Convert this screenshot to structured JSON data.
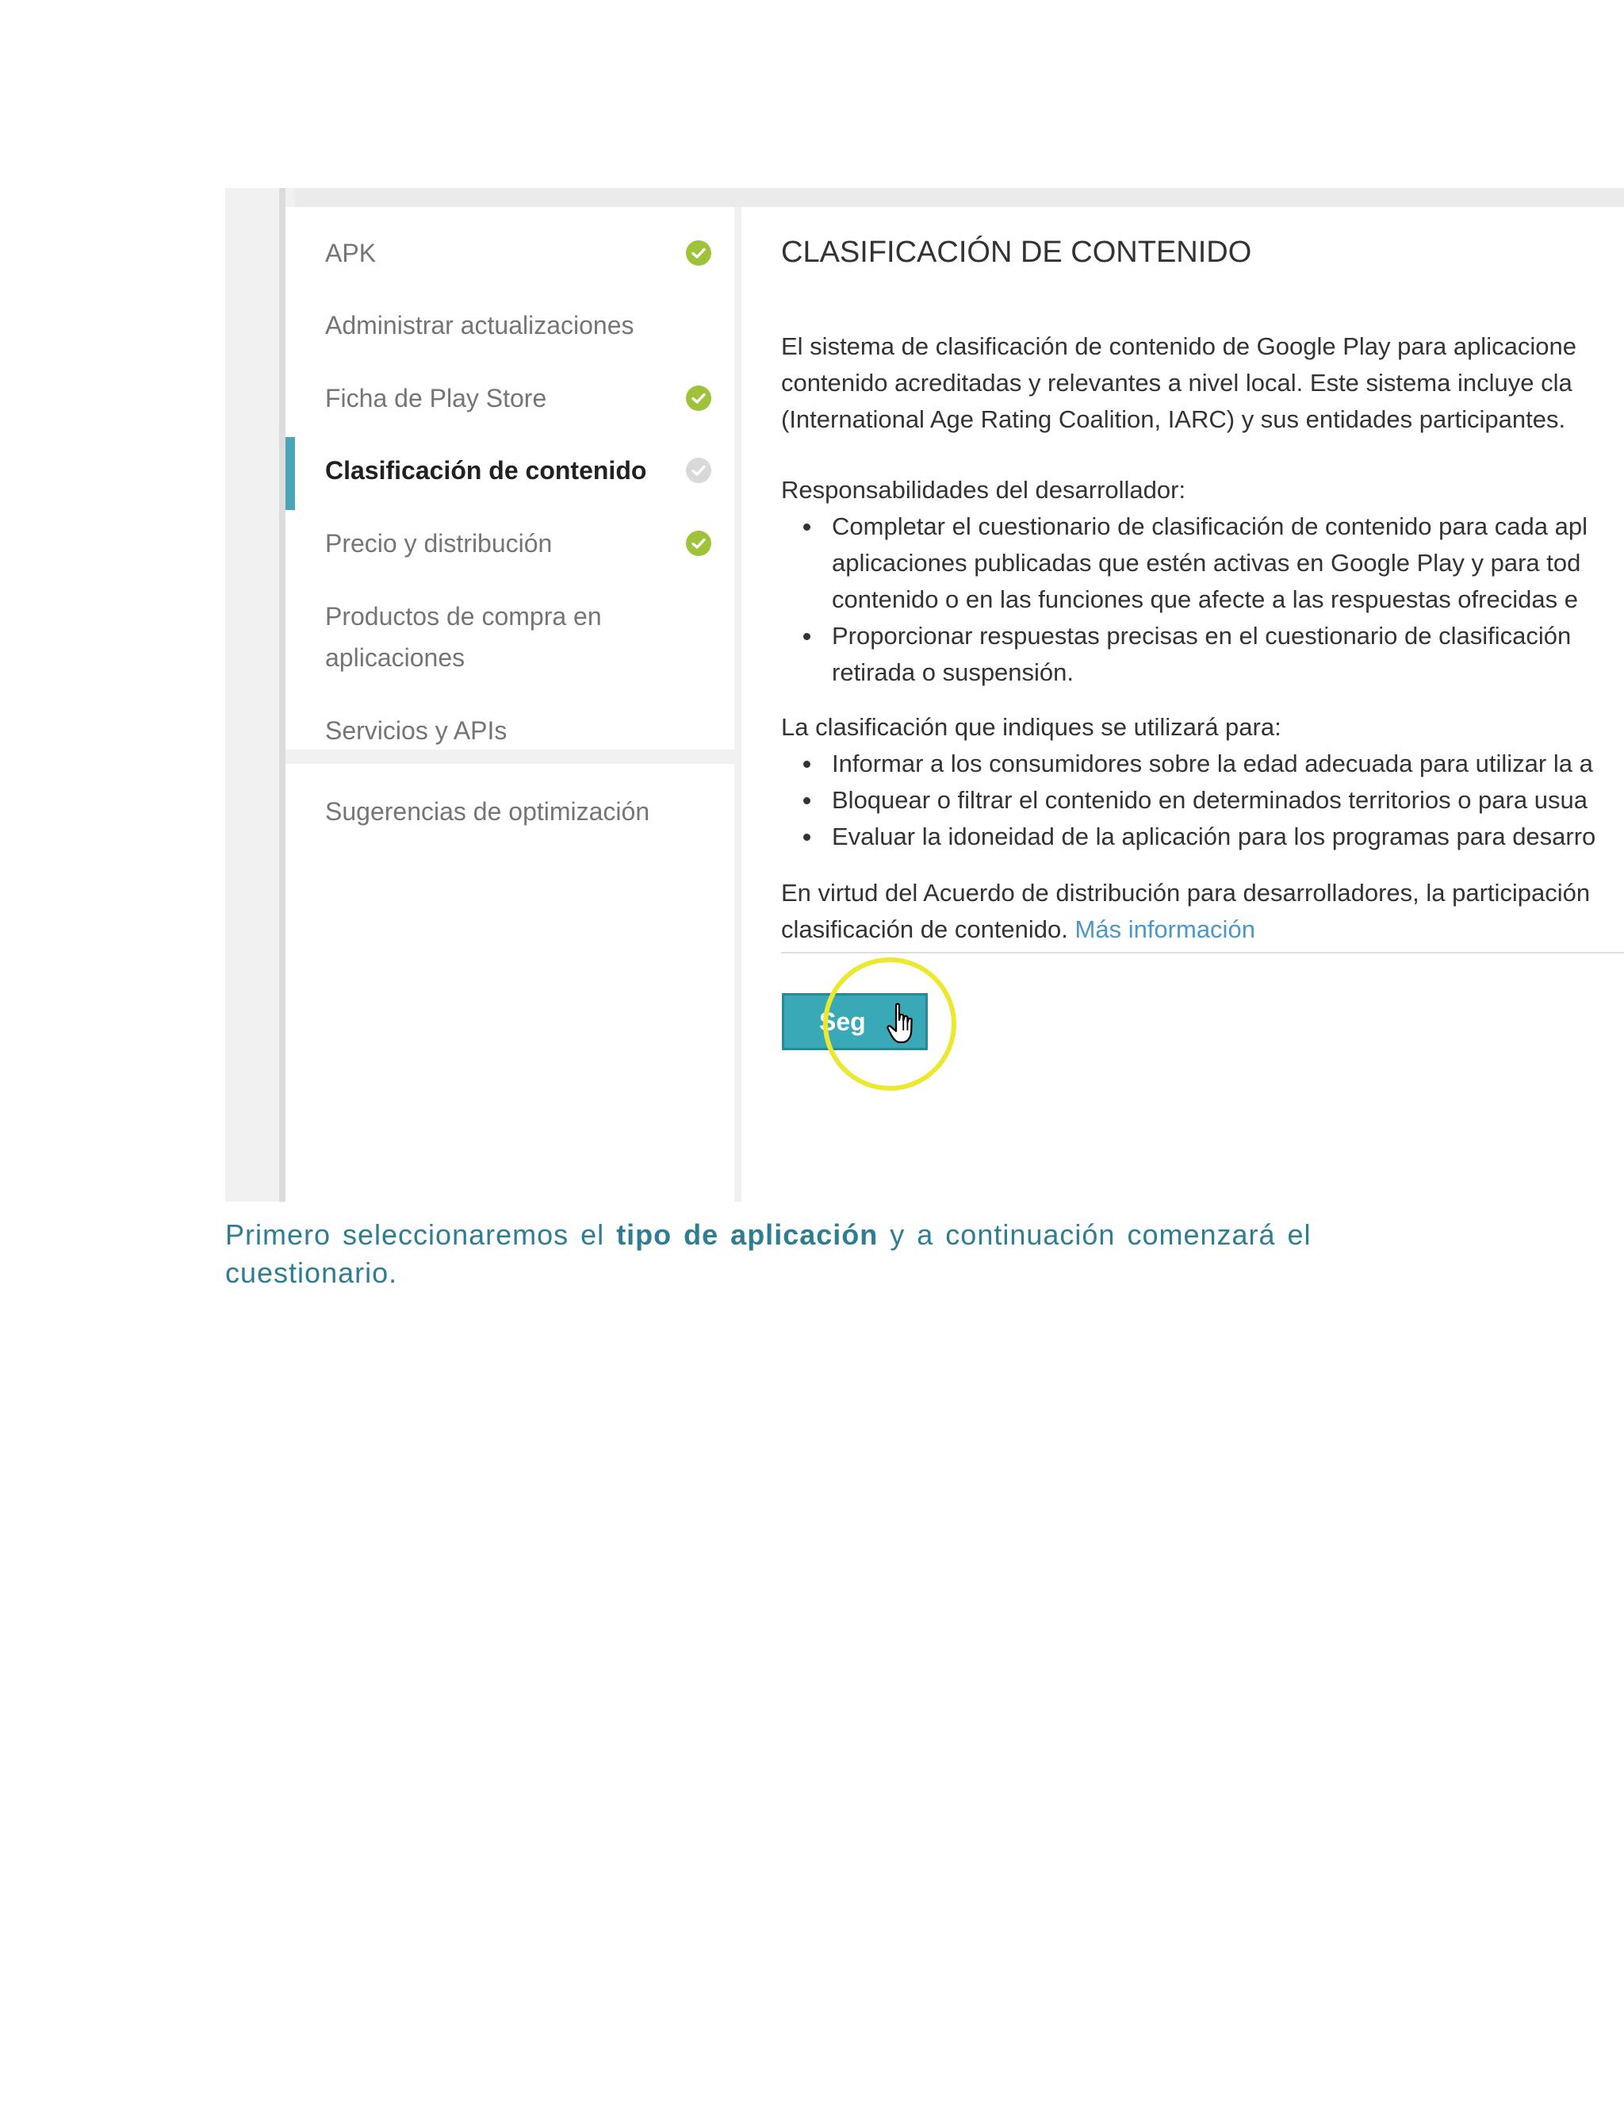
{
  "sidebar": {
    "items": [
      {
        "label": "APK",
        "status": "complete"
      },
      {
        "label": "Administrar actualizaciones"
      },
      {
        "label": "Ficha de Play Store",
        "status": "complete"
      },
      {
        "label": "Clasificación de contenido",
        "status": "incomplete",
        "active": true
      },
      {
        "label": "Precio y distribución",
        "status": "complete"
      },
      {
        "label": "Productos de compra en",
        "label_line2": "aplicaciones"
      },
      {
        "label": "Servicios y APIs"
      }
    ],
    "secondary_items": [
      {
        "label": "Sugerencias de optimización"
      }
    ]
  },
  "main": {
    "title": "CLASIFICACIÓN DE CONTENIDO",
    "intro_lines": [
      "El sistema de clasificación de contenido de Google Play para aplicacione",
      "contenido acreditadas y relevantes a nivel local. Este sistema incluye cla",
      "(International Age Rating Coalition, IARC) y sus entidades participantes."
    ],
    "responsibilities_heading": "Responsabilidades del desarrollador:",
    "responsibilities_lines": [
      "Completar el cuestionario de clasificación de contenido para cada apl",
      "aplicaciones publicadas que estén activas en Google Play y para tod",
      "contenido o en las funciones que afecte a las respuestas ofrecidas e",
      "Proporcionar respuestas precisas en el cuestionario de clasificación",
      "retirada o suspensión."
    ],
    "usage_heading": "La clasificación que indiques se utilizará para:",
    "usage_items": [
      "Informar a los consumidores sobre la edad adecuada para utilizar la a",
      "Bloquear o filtrar el contenido en determinados territorios o para usua",
      "Evaluar la idoneidad de la aplicación para los programas para desarro"
    ],
    "agreement_line1": "En virtud del Acuerdo de distribución para desarrolladores, la participación",
    "agreement_line2": "clasificación de contenido.",
    "more_info_link": "Más información",
    "continue_button_visible": "Seg"
  },
  "caption": {
    "part1": "Primero seleccionaremos el",
    "bold": "tipo de aplicación",
    "part2": "y a continuación comenzará el cuestionario."
  },
  "colors": {
    "accent": "#4aa6b6",
    "check": "#9ec33b",
    "check_incomplete": "#d9d9d9",
    "caption": "#2e7d92",
    "link": "#4a97c8",
    "click_highlight": "#ece82e"
  },
  "icons": {
    "complete": "check-circle-icon",
    "incomplete": "check-circle-grey-icon",
    "pointer": "hand-pointer-icon"
  }
}
